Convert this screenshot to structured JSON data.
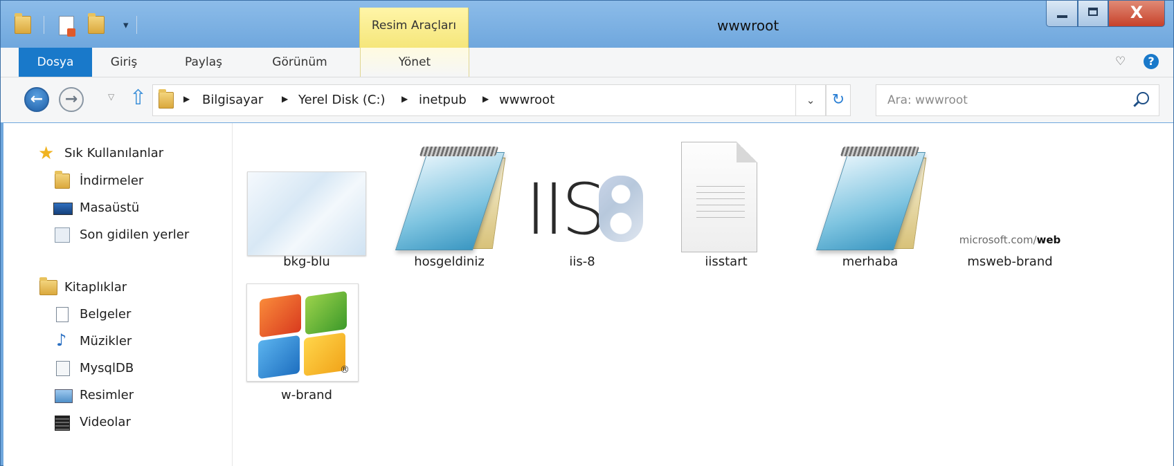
{
  "window": {
    "title": "wwwroot",
    "context_tab_group": "Resim Araçları",
    "close_symbol": "X"
  },
  "ribbon": {
    "tabs": [
      {
        "label": "Dosya"
      },
      {
        "label": "Giriş"
      },
      {
        "label": "Paylaş"
      },
      {
        "label": "Görünüm"
      },
      {
        "label": "Yönet"
      }
    ],
    "help_symbol": "?"
  },
  "address_bar": {
    "crumbs": [
      "Bilgisayar",
      "Yerel Disk (C:)",
      "inetpub",
      "wwwroot"
    ]
  },
  "search": {
    "placeholder": "Ara: wwwroot"
  },
  "sidebar": {
    "favorites": {
      "header": "Sık Kullanılanlar",
      "items": [
        "İndirmeler",
        "Masaüstü",
        "Son gidilen yerler"
      ]
    },
    "libraries": {
      "header": "Kitaplıklar",
      "items": [
        "Belgeler",
        "Müzikler",
        "MysqlDB",
        "Resimler",
        "Videolar"
      ]
    }
  },
  "files": [
    {
      "name": "bkg-blu",
      "icon": "image-thumbnail"
    },
    {
      "name": "hosgeldiniz",
      "icon": "notepad-icon"
    },
    {
      "name": "iis-8",
      "icon": "image-thumbnail"
    },
    {
      "name": "iisstart",
      "icon": "document-icon"
    },
    {
      "name": "merhaba",
      "icon": "notepad-icon"
    },
    {
      "name": "msweb-brand",
      "icon": "image-thumbnail"
    },
    {
      "name": "w-brand",
      "icon": "image-thumbnail"
    }
  ],
  "thumbnails": {
    "iis_text": "IIS",
    "msweb_text": "microsoft.com/",
    "msweb_bold": "web",
    "registered_mark": "®"
  },
  "colors": {
    "accent": "#1979ca",
    "context_tab": "#f5e67a",
    "close_button": "#c7412a"
  }
}
